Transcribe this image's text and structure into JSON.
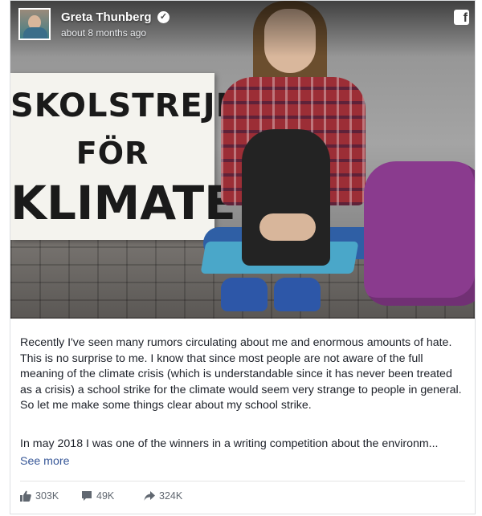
{
  "post": {
    "author_name": "Greta Thunberg",
    "timestamp": "about 8 months ago",
    "verified_icon": "verified-check-icon",
    "platform_icon": "facebook-icon",
    "image_sign_text": [
      "SKOLSTREJK",
      "FÖR",
      "KLIMATET"
    ],
    "paragraph1": "Recently I've seen many rumors circulating about me and enormous amounts of hate. This is no surprise to me. I know that since most people are not aware of the full meaning of the climate crisis (which is understandable since it has never been treated as a crisis) a school strike for the climate would seem very strange to people in general.",
    "paragraph1b": "So let me make some things clear about my school strike.",
    "paragraph2": "In may 2018 I was one of the winners in a writing competition about the environm...",
    "see_more": "See more"
  },
  "stats": {
    "likes": "303K",
    "comments": "49K",
    "shares": "324K",
    "icons": [
      "like-thumb-icon",
      "comment-bubble-icon",
      "share-arrow-icon"
    ]
  },
  "colors": {
    "link": "#385898",
    "text": "#1d2129",
    "muted": "#606770"
  }
}
